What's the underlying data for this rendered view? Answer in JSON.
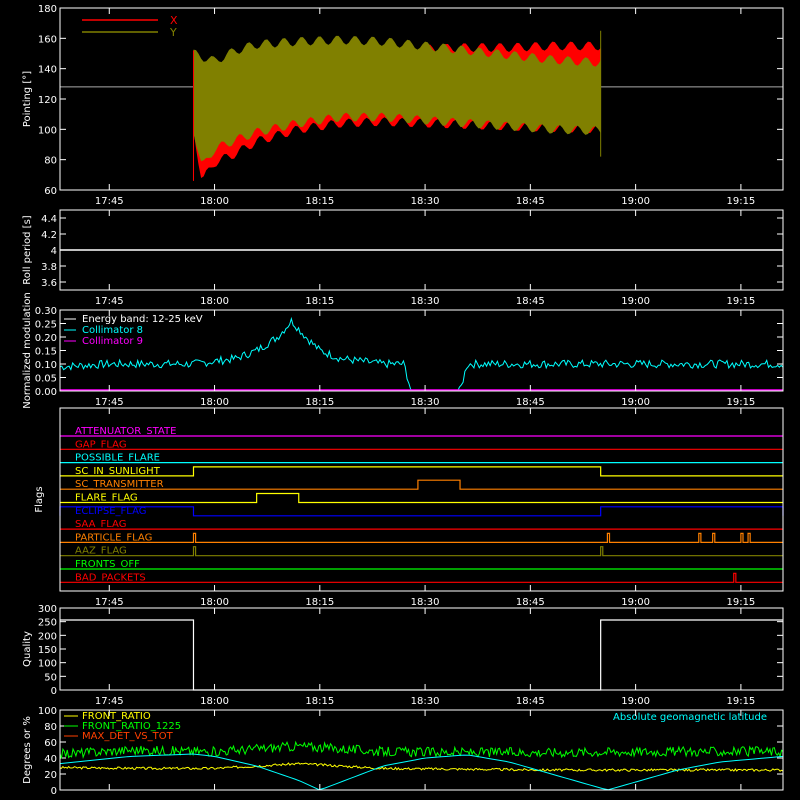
{
  "chart_data": [
    {
      "type": "area",
      "ylabel": "Pointing [°]",
      "ylim": [
        60,
        180
      ],
      "yticks": [
        60,
        80,
        100,
        120,
        140,
        160,
        180
      ],
      "xticks": [
        "17:45",
        "18:00",
        "18:15",
        "18:30",
        "18:45",
        "19:00",
        "19:15"
      ],
      "legend": [
        {
          "name": "X",
          "color": "#ff0000"
        },
        {
          "name": "Y",
          "color": "#808000"
        }
      ],
      "reference_y": 128,
      "time_range": [
        "17:57",
        "18:55"
      ],
      "series": [
        {
          "name": "X",
          "color": "#ff0000",
          "upper": [
            [
              17.95,
              152
            ],
            [
              18.0,
              128
            ],
            [
              18.05,
              135
            ],
            [
              18.1,
              142
            ],
            [
              18.2,
              147
            ],
            [
              18.3,
              150
            ],
            [
              18.4,
              152
            ],
            [
              18.5,
              153
            ],
            [
              18.6,
              154
            ],
            [
              18.7,
              154
            ],
            [
              18.8,
              155
            ],
            [
              18.917,
              155
            ]
          ],
          "lower": [
            [
              17.95,
              100
            ],
            [
              17.97,
              66
            ],
            [
              18.0,
              78
            ],
            [
              18.05,
              84
            ],
            [
              18.1,
              92
            ],
            [
              18.2,
              100
            ],
            [
              18.3,
              104
            ],
            [
              18.4,
              105
            ],
            [
              18.5,
              104
            ],
            [
              18.6,
              103
            ],
            [
              18.7,
              102
            ],
            [
              18.8,
              101
            ],
            [
              18.917,
              100
            ]
          ]
        },
        {
          "name": "Y",
          "color": "#808000",
          "upper": [
            [
              17.95,
              150
            ],
            [
              18.0,
              145
            ],
            [
              18.05,
              152
            ],
            [
              18.1,
              156
            ],
            [
              18.2,
              158
            ],
            [
              18.3,
              159
            ],
            [
              18.4,
              158
            ],
            [
              18.5,
              155
            ],
            [
              18.6,
              152
            ],
            [
              18.7,
              149
            ],
            [
              18.8,
              146
            ],
            [
              18.917,
              144
            ]
          ],
          "lower": [
            [
              17.95,
              100
            ],
            [
              17.97,
              75
            ],
            [
              18.0,
              87
            ],
            [
              18.05,
              93
            ],
            [
              18.1,
              98
            ],
            [
              18.2,
              104
            ],
            [
              18.3,
              108
            ],
            [
              18.4,
              108
            ],
            [
              18.5,
              106
            ],
            [
              18.6,
              104
            ],
            [
              18.7,
              102
            ],
            [
              18.8,
              100
            ],
            [
              18.917,
              99
            ]
          ]
        }
      ]
    },
    {
      "type": "line",
      "ylabel": "Roll period [s]",
      "ylim": [
        3.5,
        4.5
      ],
      "yticks": [
        3.6,
        3.8,
        4.0,
        4.2,
        4.4
      ],
      "xticks": [
        "17:45",
        "18:00",
        "18:15",
        "18:30",
        "18:45",
        "19:00",
        "19:15"
      ],
      "series": [
        {
          "name": "",
          "color": "#ffffff",
          "value": 4.0
        }
      ]
    },
    {
      "type": "line",
      "ylabel": "Normalized modulation",
      "ylim": [
        0,
        0.3
      ],
      "yticks": [
        "0.00",
        "0.05",
        "0.10",
        "0.15",
        "0.20",
        "0.25",
        "0.30"
      ],
      "xticks": [
        "17:45",
        "18:00",
        "18:15",
        "18:30",
        "18:45",
        "19:00",
        "19:15"
      ],
      "legend": [
        {
          "name": "Energy band: 12-25 keV",
          "color": "#ffffff"
        },
        {
          "name": "Collimator 8",
          "color": "#00ffff"
        },
        {
          "name": "Collimator 9",
          "color": "#ff00ff"
        }
      ],
      "series": [
        {
          "name": "Collimator 8",
          "color": "#00ffff",
          "points": [
            [
              17.633,
              0.09
            ],
            [
              17.75,
              0.1
            ],
            [
              17.95,
              0.1
            ],
            [
              18.05,
              0.12
            ],
            [
              18.1,
              0.15
            ],
            [
              18.15,
              0.2
            ],
            [
              18.183,
              0.26
            ],
            [
              18.217,
              0.2
            ],
            [
              18.25,
              0.15
            ],
            [
              18.3,
              0.12
            ],
            [
              18.4,
              0.1
            ],
            [
              18.45,
              0.1
            ],
            [
              18.467,
              0.0
            ],
            [
              18.583,
              0.0
            ],
            [
              18.6,
              0.1
            ],
            [
              18.8,
              0.1
            ],
            [
              19.0,
              0.1
            ],
            [
              19.2,
              0.1
            ],
            [
              19.35,
              0.1
            ]
          ],
          "gap": [
            18.47,
            18.58
          ]
        },
        {
          "name": "Collimator 9",
          "color": "#ff00ff",
          "value": 0.0
        }
      ]
    },
    {
      "type": "line",
      "ylabel": "Flags",
      "xticks": [
        "17:45",
        "18:00",
        "18:15",
        "18:30",
        "18:45",
        "19:00",
        "19:15"
      ],
      "flags": [
        {
          "name": "ATTENUATOR_STATE",
          "color": "#ff00ff",
          "on": []
        },
        {
          "name": "GAP_FLAG",
          "color": "#ff0000",
          "on": []
        },
        {
          "name": "POSSIBLE_FLARE",
          "color": "#00ffff",
          "on": []
        },
        {
          "name": "SC_IN_SUNLIGHT",
          "color": "#ffff00",
          "on": [
            [
              17.95,
              18.917
            ]
          ]
        },
        {
          "name": "SC_TRANSMITTER",
          "color": "#ff8000",
          "on": [
            [
              18.483,
              18.583
            ]
          ]
        },
        {
          "name": "FLARE_FLAG",
          "color": "#ffff00",
          "on": [
            [
              18.1,
              18.2
            ]
          ]
        },
        {
          "name": "ECLIPSE_FLAG",
          "color": "#0000ff",
          "on": [
            [
              17.633,
              17.95
            ],
            [
              18.917,
              19.35
            ]
          ]
        },
        {
          "name": "SAA_FLAG",
          "color": "#ff0000",
          "on": []
        },
        {
          "name": "PARTICLE_FLAG",
          "color": "#ff8000",
          "on": [
            [
              17.95,
              17.955
            ],
            [
              18.933,
              18.938
            ],
            [
              19.15,
              19.155
            ],
            [
              19.183,
              19.188
            ],
            [
              19.25,
              19.255
            ],
            [
              19.267,
              19.272
            ]
          ]
        },
        {
          "name": "AAZ_FLAG",
          "color": "#808000",
          "on": [
            [
              17.95,
              17.955
            ],
            [
              18.917,
              18.922
            ]
          ]
        },
        {
          "name": "FRONTS_OFF",
          "color": "#00ff00",
          "on": []
        },
        {
          "name": "BAD_PACKETS",
          "color": "#ff0000",
          "on": [
            [
              19.233,
              19.238
            ]
          ]
        }
      ]
    },
    {
      "type": "line",
      "ylabel": "Quality",
      "ylim": [
        0,
        300
      ],
      "yticks": [
        0,
        50,
        100,
        150,
        200,
        250,
        300
      ],
      "xticks": [
        "17:45",
        "18:00",
        "18:15",
        "18:30",
        "18:45",
        "19:00",
        "19:15"
      ],
      "series": [
        {
          "name": "",
          "color": "#ffffff",
          "points": [
            [
              17.633,
              256
            ],
            [
              17.95,
              256
            ],
            [
              17.95,
              0
            ],
            [
              18.917,
              0
            ],
            [
              18.917,
              256
            ],
            [
              19.35,
              256
            ]
          ]
        }
      ]
    },
    {
      "type": "line",
      "ylabel": "Degrees or %",
      "ylim": [
        0,
        100
      ],
      "yticks": [
        0,
        20,
        40,
        60,
        80,
        100
      ],
      "legend": [
        {
          "name": "FRONT_RATIO",
          "color": "#ffff00"
        },
        {
          "name": "FRONT_RATIO_1225",
          "color": "#00ff00"
        },
        {
          "name": "MAX_DET_VS_TOT",
          "color": "#ff4000"
        },
        {
          "name": "Absolute geomagnetic latitude",
          "color": "#00ffff"
        }
      ],
      "series": [
        {
          "name": "FRONT_RATIO",
          "color": "#ffff00",
          "points": [
            [
              17.633,
              28
            ],
            [
              17.85,
              27
            ],
            [
              18.0,
              27
            ],
            [
              18.1,
              30
            ],
            [
              18.2,
              33
            ],
            [
              18.3,
              30
            ],
            [
              18.4,
              27
            ],
            [
              18.6,
              26
            ],
            [
              18.8,
              25
            ],
            [
              19.0,
              25
            ],
            [
              19.2,
              25
            ],
            [
              19.35,
              25
            ]
          ]
        },
        {
          "name": "FRONT_RATIO_1225",
          "color": "#00ff00",
          "points": [
            [
              17.633,
              45
            ],
            [
              17.8,
              50
            ],
            [
              18.0,
              48
            ],
            [
              18.2,
              55
            ],
            [
              18.4,
              48
            ],
            [
              18.6,
              47
            ],
            [
              18.8,
              47
            ],
            [
              19.0,
              48
            ],
            [
              19.2,
              48
            ],
            [
              19.35,
              48
            ]
          ]
        },
        {
          "name": "MAX_DET_VS_TOT",
          "color": "#ff4000",
          "points": [
            [
              17.633,
              0
            ],
            [
              19.35,
              0
            ]
          ]
        },
        {
          "name": "Absolute geomagnetic latitude",
          "color": "#00ffff",
          "points": [
            [
              17.633,
              33
            ],
            [
              17.8,
              42
            ],
            [
              17.95,
              45
            ],
            [
              18.0,
              42
            ],
            [
              18.1,
              30
            ],
            [
              18.2,
              12
            ],
            [
              18.25,
              0
            ],
            [
              18.3,
              10
            ],
            [
              18.4,
              30
            ],
            [
              18.5,
              40
            ],
            [
              18.6,
              44
            ],
            [
              18.7,
              35
            ],
            [
              18.8,
              20
            ],
            [
              18.9,
              5
            ],
            [
              18.933,
              0
            ],
            [
              19.0,
              10
            ],
            [
              19.1,
              25
            ],
            [
              19.2,
              35
            ],
            [
              19.35,
              42
            ]
          ]
        }
      ]
    }
  ]
}
